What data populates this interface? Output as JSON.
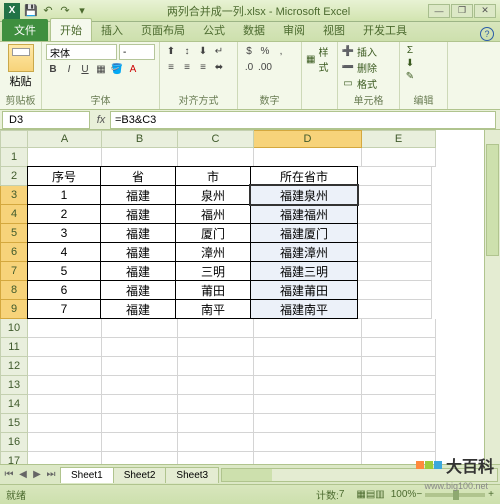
{
  "window": {
    "title": "两列合并成一列.xlsx - Microsoft Excel"
  },
  "qat": {
    "save": "💾",
    "undo": "↶",
    "redo": "↷"
  },
  "tabs": {
    "file": "文件",
    "home": "开始",
    "insert": "插入",
    "layout": "页面布局",
    "formula": "公式",
    "data": "数据",
    "review": "审阅",
    "view": "视图",
    "dev": "开发工具"
  },
  "ribbon": {
    "clipboard": {
      "paste": "粘贴",
      "label": "剪贴板"
    },
    "font": {
      "name": "宋体",
      "size": "-",
      "label": "字体"
    },
    "align": {
      "label": "对齐方式"
    },
    "number": {
      "label": "数字"
    },
    "style": {
      "btn": "样式",
      "label": ""
    },
    "cells": {
      "insert": "插入",
      "delete": "删除",
      "format": "格式",
      "label": "单元格"
    },
    "edit": {
      "label": "编辑"
    }
  },
  "namebox": "D3",
  "formula": "=B3&C3",
  "columns": [
    "A",
    "B",
    "C",
    "D",
    "E"
  ],
  "rows_visible": 17,
  "table": {
    "headers": {
      "A": "序号",
      "B": "省",
      "C": "市",
      "D": "所在省市"
    },
    "rows": [
      {
        "A": "1",
        "B": "福建",
        "C": "泉州",
        "D": "福建泉州"
      },
      {
        "A": "2",
        "B": "福建",
        "C": "福州",
        "D": "福建福州"
      },
      {
        "A": "3",
        "B": "福建",
        "C": "厦门",
        "D": "福建厦门"
      },
      {
        "A": "4",
        "B": "福建",
        "C": "漳州",
        "D": "福建漳州"
      },
      {
        "A": "5",
        "B": "福建",
        "C": "三明",
        "D": "福建三明"
      },
      {
        "A": "6",
        "B": "福建",
        "C": "莆田",
        "D": "福建莆田"
      },
      {
        "A": "7",
        "B": "福建",
        "C": "南平",
        "D": "福建南平"
      }
    ]
  },
  "selection": {
    "active": "D3",
    "range_start": 3,
    "range_end": 9,
    "col": "D"
  },
  "sheets": [
    "Sheet1",
    "Sheet2",
    "Sheet3"
  ],
  "status": {
    "ready": "就绪",
    "count_label": "计数:",
    "count": "7",
    "zoom": "100%"
  },
  "watermark": {
    "brand": "大百科",
    "url": "www.big100.net"
  }
}
